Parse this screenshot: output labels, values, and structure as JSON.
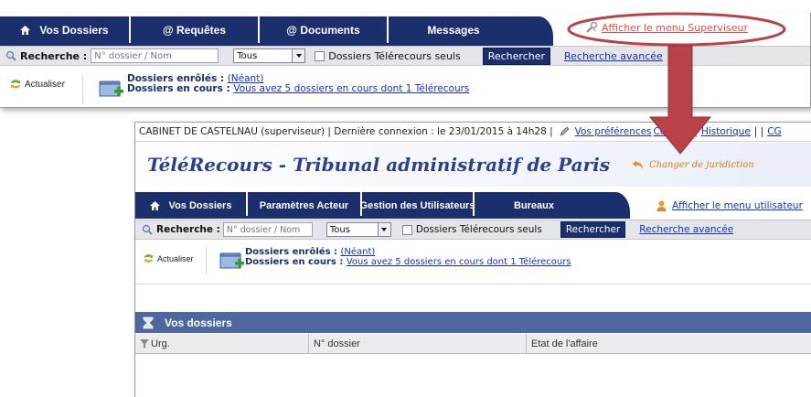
{
  "top_panel": {
    "tabs": [
      {
        "label": "Vos Dossiers",
        "home": true
      },
      {
        "label": "@ Requêtes"
      },
      {
        "label": "@ Documents"
      },
      {
        "label": "Messages"
      }
    ],
    "supervisor_link": "Afficher le menu Superviseur",
    "search": {
      "label": "Recherche :",
      "placeholder": "N° dossier / Nom",
      "select_value": "Tous",
      "checkbox_label": "Dossiers Télérecours seuls",
      "button_label": "Rechercher",
      "advanced_link": "Recherche avancée"
    },
    "refresh_label": "Actualiser",
    "enrolled_label": "Dossiers enrôlés :",
    "enrolled_value": "(Néant)",
    "current_label": "Dossiers en cours :",
    "current_value": "Vous avez 5 dossiers en cours dont 1 Télérecours"
  },
  "bottom_panel": {
    "topline": {
      "user_info": "CABINET DE CASTELNAU (superviseur) | Dernière connexion : le 23/01/2015 à 14h28 |",
      "prefs_link": "Vos préférences",
      "contact_link": "Contact",
      "history_link": "Historique",
      "sep_tail": "| |",
      "cg_link": "CG"
    },
    "title": "TéléRecours - Tribunal administratif de Paris",
    "change_jurisdiction": "Changer de juridiction",
    "tabs": [
      {
        "label": "Vos Dossiers",
        "home": true
      },
      {
        "label": "Paramètres Acteur"
      },
      {
        "label": "Gestion des Utilisateurs"
      },
      {
        "label": "Bureaux"
      }
    ],
    "user_menu_link": "Afficher le menu utilisateur",
    "search": {
      "label": "Recherche :",
      "placeholder": "N° dossier / Nom",
      "select_value": "Tous",
      "checkbox_label": "Dossiers Télérecours seuls",
      "button_label": "Rechercher",
      "advanced_link": "Recherche avancée"
    },
    "refresh_label": "Actualiser",
    "enrolled_label": "Dossiers enrôlés :",
    "enrolled_value": "(Néant)",
    "current_label": "Dossiers en cours :",
    "current_value": "Vous avez 5 dossiers en cours dont 1 Télérecours",
    "vos_dossiers_title": "Vos dossiers",
    "columns": [
      "Urg.",
      "N° dossier",
      "Etat de l'affaire"
    ]
  },
  "colors": {
    "tab_navy": "#1a2f6c",
    "link_blue": "#1a2fb8",
    "highlight_red": "#b8424a",
    "orange": "#d97a1a"
  }
}
